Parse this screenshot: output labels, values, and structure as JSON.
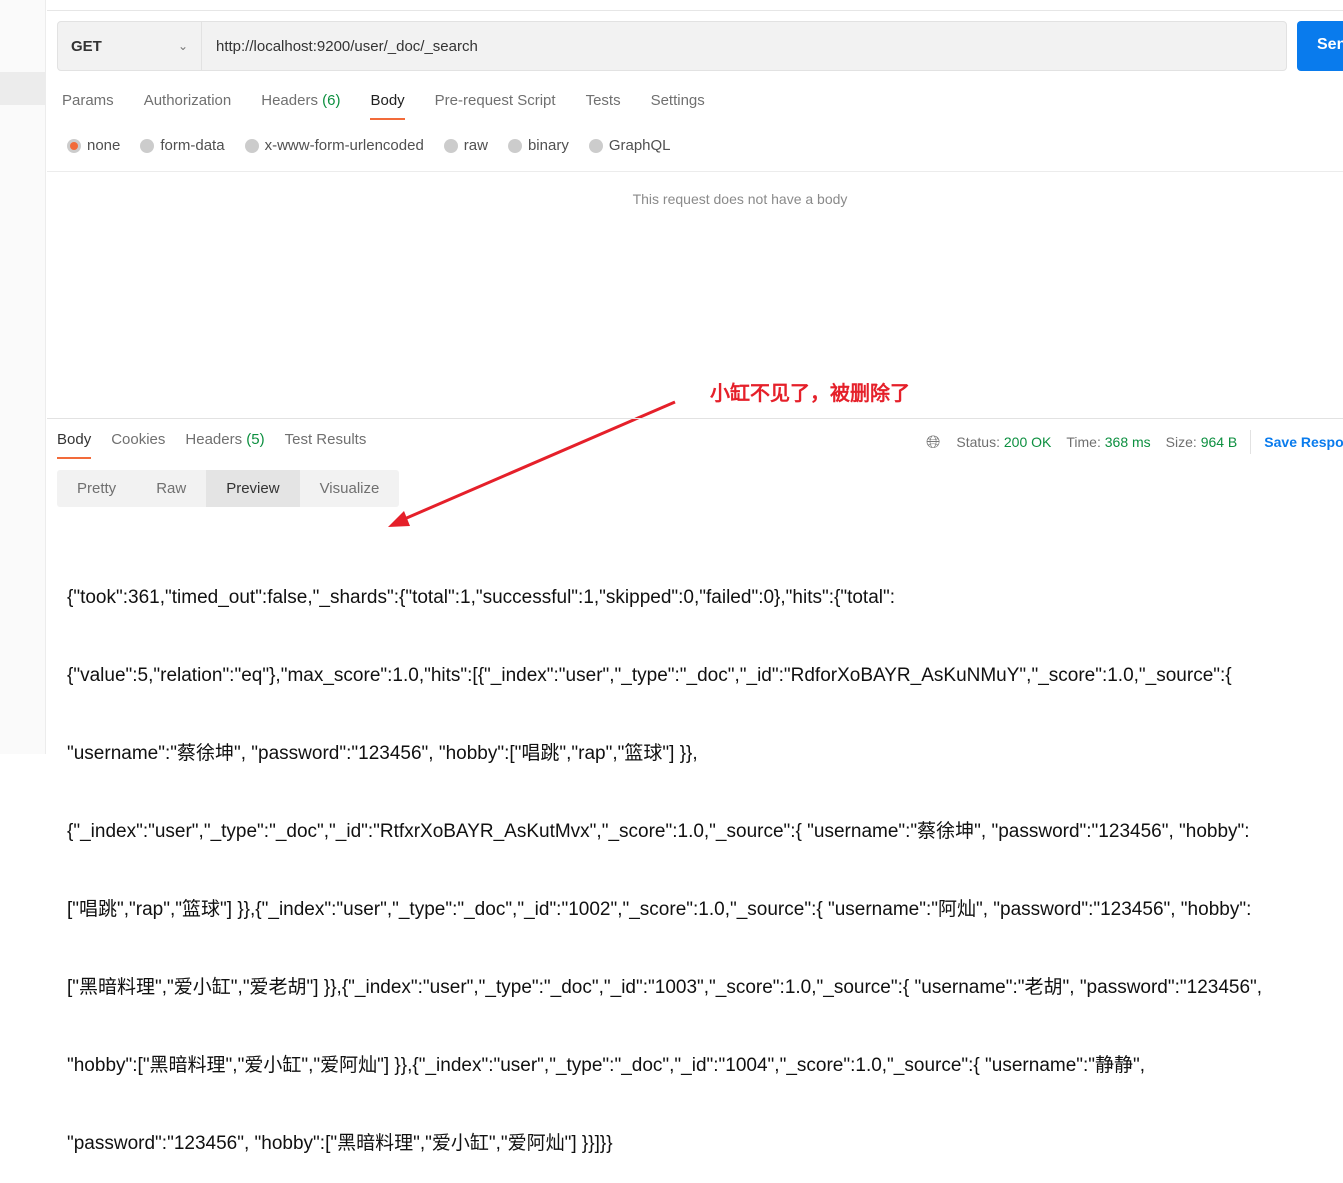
{
  "request": {
    "method": "GET",
    "url": "http://localhost:9200/user/_doc/_search",
    "send_label": "Send"
  },
  "req_tabs": [
    {
      "label": "Params"
    },
    {
      "label": "Authorization"
    },
    {
      "label": "Headers",
      "count": "(6)"
    },
    {
      "label": "Body",
      "active": true
    },
    {
      "label": "Pre-request Script"
    },
    {
      "label": "Tests"
    },
    {
      "label": "Settings"
    }
  ],
  "body_types": [
    {
      "label": "none",
      "selected": true
    },
    {
      "label": "form-data"
    },
    {
      "label": "x-www-form-urlencoded"
    },
    {
      "label": "raw"
    },
    {
      "label": "binary"
    },
    {
      "label": "GraphQL"
    }
  ],
  "no_body_text": "This request does not have a body",
  "res_tabs": [
    {
      "label": "Body",
      "active": true
    },
    {
      "label": "Cookies"
    },
    {
      "label": "Headers",
      "count": "(5)"
    },
    {
      "label": "Test Results"
    }
  ],
  "status": {
    "status_label": "Status:",
    "status": "200 OK",
    "time_label": "Time:",
    "time": "368 ms",
    "size_label": "Size:",
    "size": "964 B",
    "save_label": "Save Response"
  },
  "view_modes": [
    {
      "label": "Pretty"
    },
    {
      "label": "Raw"
    },
    {
      "label": "Preview",
      "active": true
    },
    {
      "label": "Visualize"
    }
  ],
  "response_lines": [
    "{\"took\":361,\"timed_out\":false,\"_shards\":{\"total\":1,\"successful\":1,\"skipped\":0,\"failed\":0},\"hits\":{\"total\":",
    "{\"value\":5,\"relation\":\"eq\"},\"max_score\":1.0,\"hits\":[{\"_index\":\"user\",\"_type\":\"_doc\",\"_id\":\"RdforXoBAYR_AsKuNMuY\",\"_score\":1.0,\"_source\":{",
    "\"username\":\"蔡徐坤\", \"password\":\"123456\", \"hobby\":[\"唱跳\",\"rap\",\"篮球\"] }},",
    "{\"_index\":\"user\",\"_type\":\"_doc\",\"_id\":\"RtfxrXoBAYR_AsKutMvx\",\"_score\":1.0,\"_source\":{ \"username\":\"蔡徐坤\", \"password\":\"123456\", \"hobby\":",
    "[\"唱跳\",\"rap\",\"篮球\"] }},{\"_index\":\"user\",\"_type\":\"_doc\",\"_id\":\"1002\",\"_score\":1.0,\"_source\":{ \"username\":\"阿灿\", \"password\":\"123456\", \"hobby\":",
    "[\"黑暗料理\",\"爱小缸\",\"爱老胡\"] }},{\"_index\":\"user\",\"_type\":\"_doc\",\"_id\":\"1003\",\"_score\":1.0,\"_source\":{ \"username\":\"老胡\", \"password\":\"123456\",",
    "\"hobby\":[\"黑暗料理\",\"爱小缸\",\"爱阿灿\"] }},{\"_index\":\"user\",\"_type\":\"_doc\",\"_id\":\"1004\",\"_score\":1.0,\"_source\":{ \"username\":\"静静\",",
    "\"password\":\"123456\", \"hobby\":[\"黑暗料理\",\"爱小缸\",\"爱阿灿\"] }}]}}"
  ],
  "annotation": {
    "text": "小缸不见了，被删除了",
    "color": "#e5202a"
  },
  "colors": {
    "accent": "#f26b3a",
    "send": "#097bed",
    "success": "#0c8f3f"
  }
}
